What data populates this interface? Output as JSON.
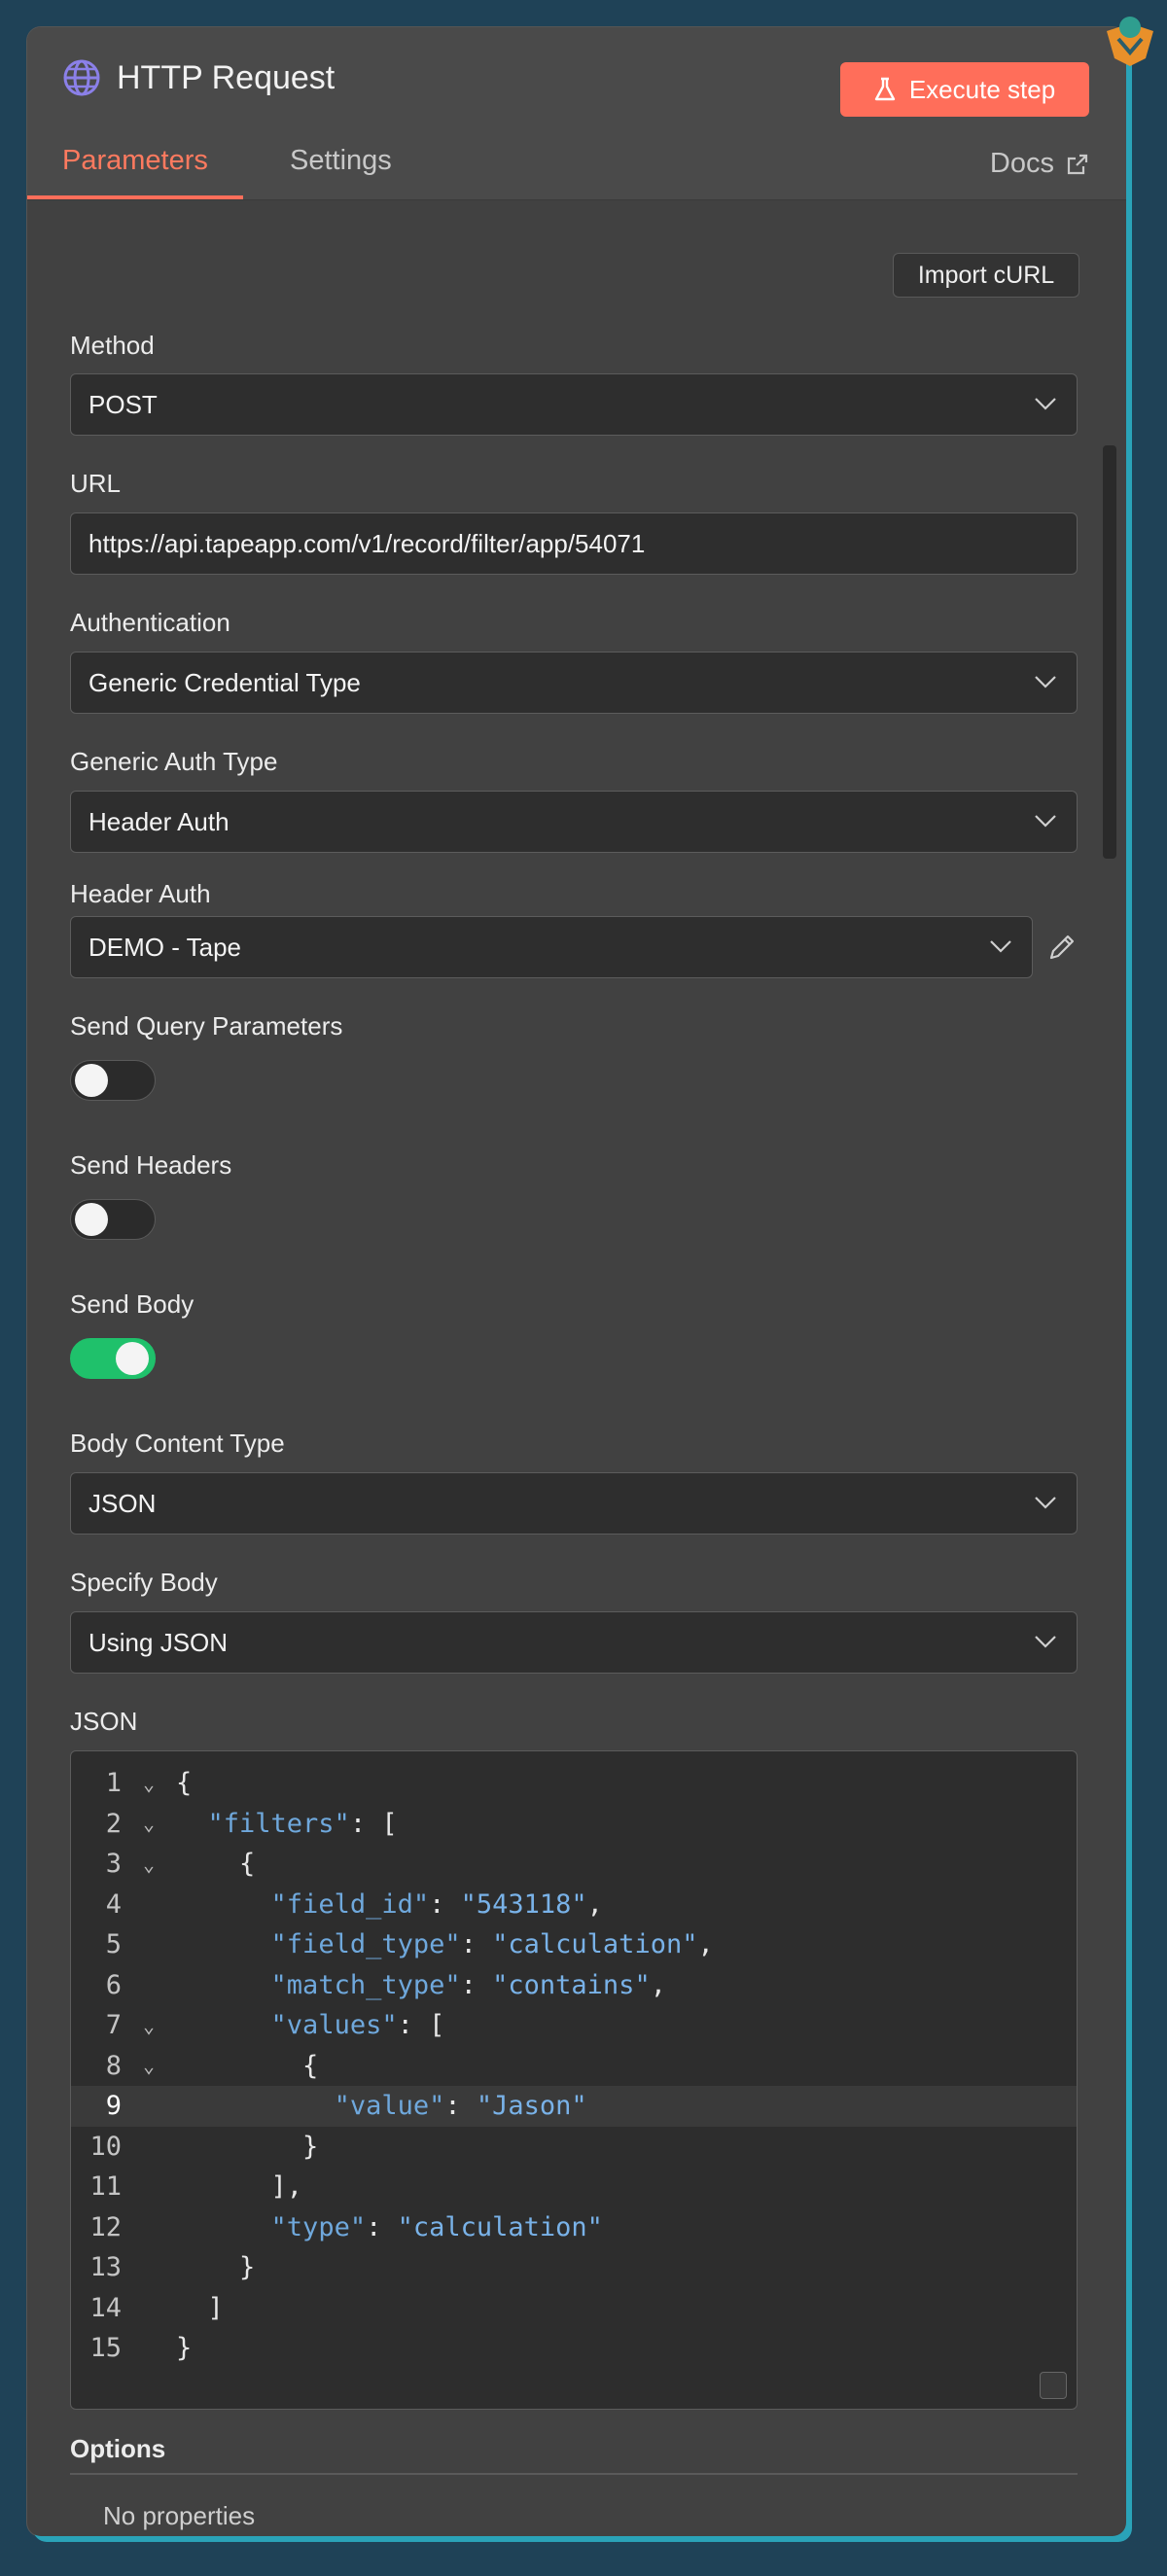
{
  "header": {
    "title": "HTTP Request",
    "execute_label": "Execute step",
    "tabs": [
      {
        "label": "Parameters"
      },
      {
        "label": "Settings"
      }
    ],
    "docs_label": "Docs"
  },
  "import_label": "Import cURL",
  "fields": {
    "method": {
      "label": "Method",
      "value": "POST"
    },
    "url": {
      "label": "URL",
      "value": "https://api.tapeapp.com/v1/record/filter/app/54071"
    },
    "authentication": {
      "label": "Authentication",
      "value": "Generic Credential Type"
    },
    "generic_auth_type": {
      "label": "Generic Auth Type",
      "value": "Header Auth"
    },
    "header_auth": {
      "label": "Header Auth",
      "value": "DEMO - Tape"
    },
    "send_query": {
      "label": "Send Query Parameters",
      "on": false
    },
    "send_headers": {
      "label": "Send Headers",
      "on": false
    },
    "send_body": {
      "label": "Send Body",
      "on": true
    },
    "body_content_type": {
      "label": "Body Content Type",
      "value": "JSON"
    },
    "specify_body": {
      "label": "Specify Body",
      "value": "Using JSON"
    }
  },
  "json_editor": {
    "label": "JSON",
    "active_line": 9,
    "lines": [
      "{",
      "  \"filters\": [",
      "    {",
      "      \"field_id\": \"543118\",",
      "      \"field_type\": \"calculation\",",
      "      \"match_type\": \"contains\",",
      "      \"values\": [",
      "        {",
      "          \"value\": \"Jason\"",
      "        }",
      "      ],",
      "      \"type\": \"calculation\"",
      "    }",
      "  ]",
      "}"
    ],
    "folds": [
      1,
      2,
      3,
      7,
      8
    ]
  },
  "options": {
    "title": "Options",
    "empty_text": "No properties"
  },
  "colors": {
    "accent": "#ff6e5a",
    "toggle_on": "#1fc16b",
    "panel": "#414141",
    "background": "#1f4257"
  }
}
